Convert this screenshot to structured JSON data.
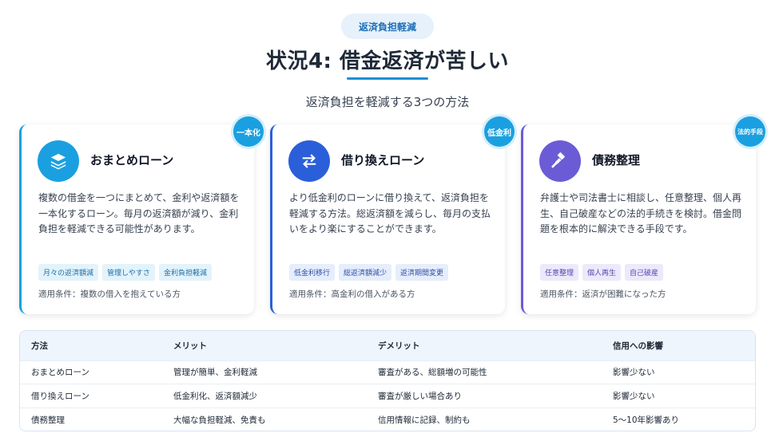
{
  "header": {
    "pill": "返済負担軽減",
    "title": "状況4: 借金返済が苦しい",
    "subtitle": "返済負担を軽減する3つの方法"
  },
  "cards": [
    {
      "badge": "一本化",
      "icon": "layers-icon",
      "title": "おまとめローン",
      "desc": "複数の借金を一つにまとめて、金利や返済額を一本化するローン。毎月の返済額が減り、金利負担を軽減できる可能性があります。",
      "tags": [
        "月々の返済額減",
        "管理しやすさ",
        "金利負担軽減"
      ],
      "condition": "適用条件：複数の借入を抱えている方"
    },
    {
      "badge": "低金利",
      "icon": "exchange-icon",
      "title": "借り換えローン",
      "desc": "より低金利のローンに借り換えて、返済負担を軽減する方法。総返済額を減らし、毎月の支払いをより楽にすることができます。",
      "tags": [
        "低金利移行",
        "総返済額減少",
        "返済期間変更"
      ],
      "condition": "適用条件：高金利の借入がある方"
    },
    {
      "badge": "法的手段",
      "icon": "gavel-icon",
      "title": "債務整理",
      "desc": "弁護士や司法書士に相談し、任意整理、個人再生、自己破産などの法的手続きを検討。借金問題を根本的に解決できる手段です。",
      "tags": [
        "任意整理",
        "個人再生",
        "自己破産"
      ],
      "condition": "適用条件：返済が困難になった方"
    }
  ],
  "table": {
    "headers": [
      "方法",
      "メリット",
      "デメリット",
      "信用への影響"
    ],
    "rows": [
      [
        "おまとめローン",
        "管理が簡単、金利軽減",
        "審査がある、総額増の可能性",
        "影響少ない"
      ],
      [
        "借り換えローン",
        "低金利化、返済額減少",
        "審査が厳しい場合あり",
        "影響少ない"
      ],
      [
        "債務整理",
        "大幅な負担軽減、免責も",
        "信用情報に記録、制約も",
        "5〜10年影響あり"
      ]
    ]
  },
  "colors": {
    "card1": "#1aa0e0",
    "card2": "#2b5fd9",
    "card3": "#6b5cd6"
  }
}
